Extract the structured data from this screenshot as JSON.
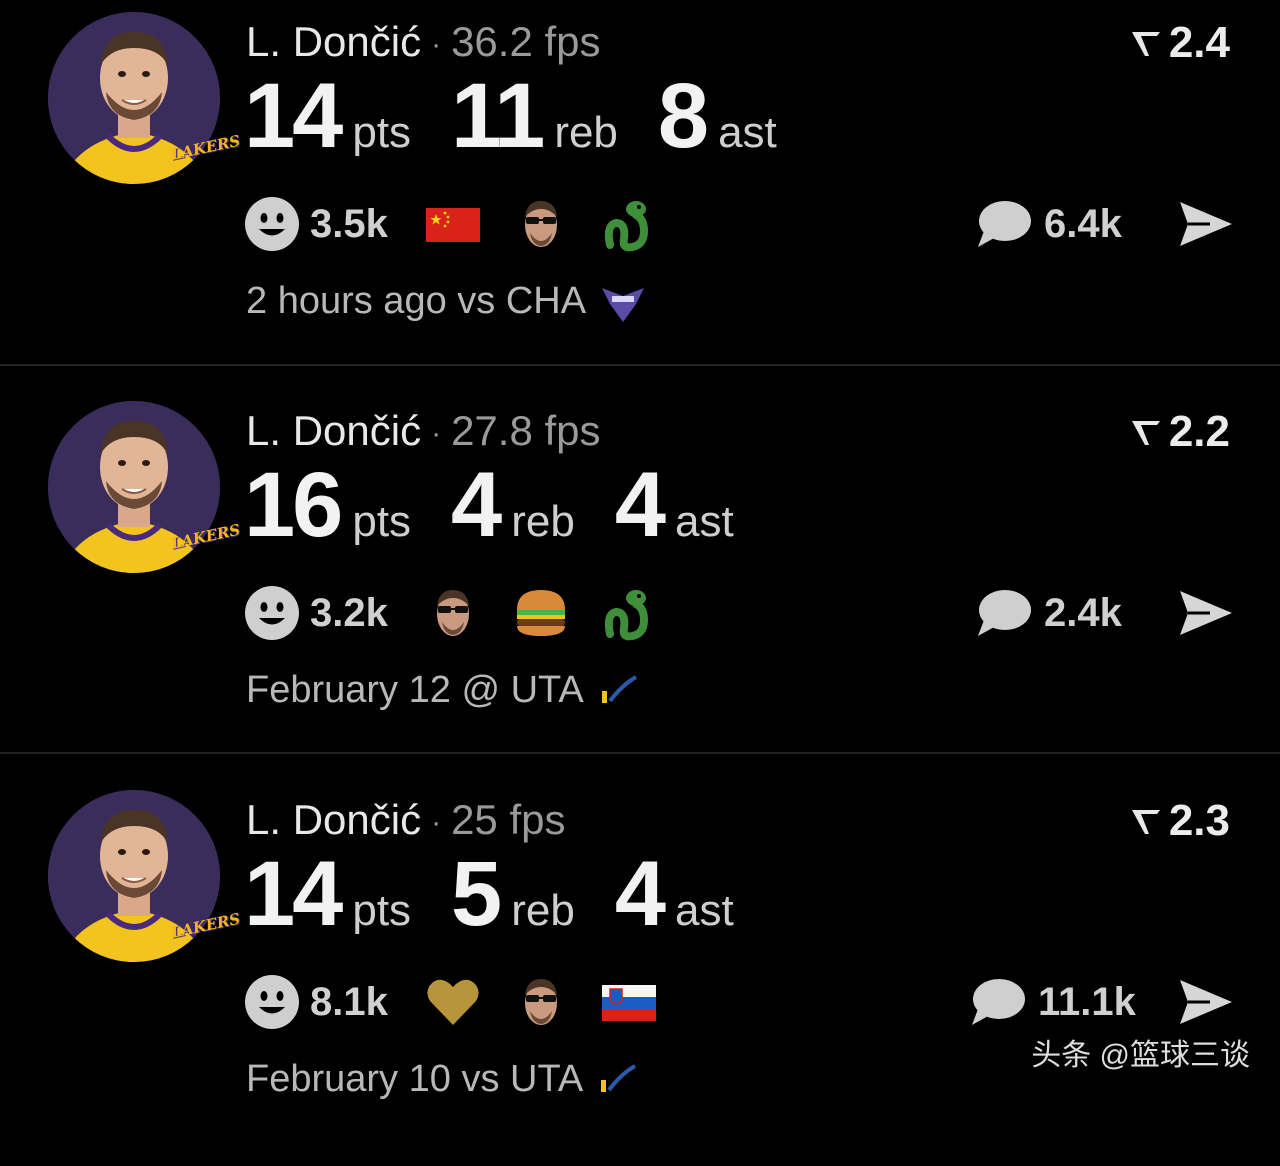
{
  "cards": [
    {
      "player": "L. Dončić",
      "separator": "·",
      "fps": "36.2 fps",
      "rating": "2.4",
      "stats": [
        {
          "value": "14",
          "unit": "pts"
        },
        {
          "value": "11",
          "unit": "reb"
        },
        {
          "value": "8",
          "unit": "ast"
        }
      ],
      "reaction_count": "3.5k",
      "emojis": [
        "china-flag-emoji",
        "sunglasses-luka-emoji",
        "snake-emoji"
      ],
      "comment_count": "6.4k",
      "meta": "2 hours ago vs CHA",
      "team_logo": "hornets-logo"
    },
    {
      "player": "L. Dončić",
      "separator": "·",
      "fps": "27.8 fps",
      "rating": "2.2",
      "stats": [
        {
          "value": "16",
          "unit": "pts"
        },
        {
          "value": "4",
          "unit": "reb"
        },
        {
          "value": "4",
          "unit": "ast"
        }
      ],
      "reaction_count": "3.2k",
      "emojis": [
        "sunglasses-luka-emoji",
        "burger-emoji",
        "snake-emoji"
      ],
      "comment_count": "2.4k",
      "meta": "February 12 @ UTA",
      "team_logo": "jazz-logo"
    },
    {
      "player": "L. Dončić",
      "separator": "·",
      "fps": "25 fps",
      "rating": "2.3",
      "stats": [
        {
          "value": "14",
          "unit": "pts"
        },
        {
          "value": "5",
          "unit": "reb"
        },
        {
          "value": "4",
          "unit": "ast"
        }
      ],
      "reaction_count": "8.1k",
      "emojis": [
        "gold-heart-emoji",
        "sunglasses-luka-emoji",
        "slovenia-flag-emoji"
      ],
      "comment_count": "11.1k",
      "meta": "February 10 vs UTA",
      "team_logo": "jazz-logo"
    }
  ],
  "avatar_badge": "LAKERS",
  "watermark": "头条 @篮球三谈",
  "colors": {
    "background": "#000000",
    "divider": "#222222",
    "jersey": "#f2c41d",
    "avatar_bg": "#3a2d5c"
  }
}
